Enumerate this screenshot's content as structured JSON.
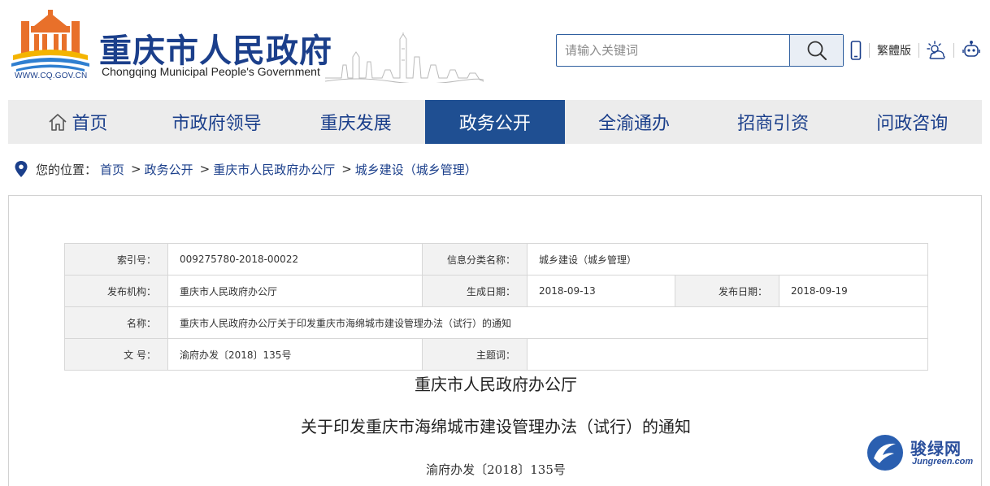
{
  "header": {
    "site_title": "重庆市人民政府",
    "site_subtitle": "Chongqing Municipal People's Government",
    "logo_url_text": "WWW.CQ.GOV.CN",
    "search": {
      "placeholder": "请输入关键词"
    },
    "tools": {
      "traditional_label": "繁體版"
    }
  },
  "nav": {
    "items": [
      {
        "label": "首页",
        "icon": "home-icon",
        "active": false
      },
      {
        "label": "市政府领导",
        "active": false
      },
      {
        "label": "重庆发展",
        "active": false
      },
      {
        "label": "政务公开",
        "active": true
      },
      {
        "label": "全渝通办",
        "active": false
      },
      {
        "label": "招商引资",
        "active": false
      },
      {
        "label": "问政咨询",
        "active": false
      }
    ]
  },
  "breadcrumb": {
    "prefix": "您的位置：",
    "items": [
      "首页",
      "政务公开",
      "重庆市人民政府办公厅",
      "城乡建设（城乡管理）"
    ],
    "separator": ">"
  },
  "meta": {
    "index_label": "索引号：",
    "index_value": "009275780-2018-00022",
    "category_label": "信息分类名称：",
    "category_value": "城乡建设（城乡管理）",
    "publisher_label": "发布机构：",
    "publisher_value": "重庆市人民政府办公厅",
    "created_label": "生成日期：",
    "created_value": "2018-09-13",
    "published_label": "发布日期：",
    "published_value": "2018-09-19",
    "name_label": "名称：",
    "name_value": "重庆市人民政府办公厅关于印发重庆市海绵城市建设管理办法（试行）的通知",
    "docno_label": "文 号：",
    "docno_value": "渝府办发〔2018〕135号",
    "keywords_label": "主题词：",
    "keywords_value": ""
  },
  "document": {
    "issuer": "重庆市人民政府办公厅",
    "title": "关于印发重庆市海绵城市建设管理办法（试行）的通知",
    "number": "渝府办发〔2018〕135号"
  },
  "watermark": {
    "text": "骏绿网",
    "sub": "Jungreen.com"
  },
  "colors": {
    "brand_blue": "#1b3f8b",
    "nav_active": "#1f4f92",
    "nav_bg": "#ececec",
    "logo_orange": "#e8702a",
    "logo_yellow": "#f4b400",
    "logo_blue": "#2f7fd0"
  }
}
